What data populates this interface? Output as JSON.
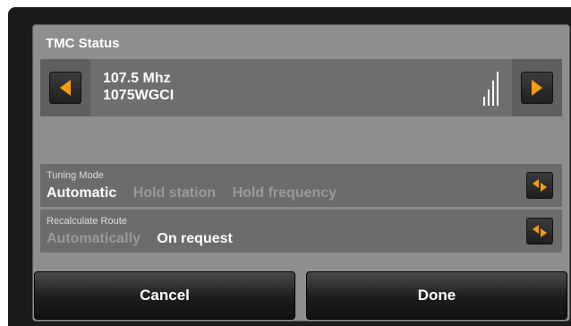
{
  "dialog": {
    "title": "TMC Status"
  },
  "station": {
    "frequency": "107.5 Mhz",
    "name": "1075WGCI",
    "signal_bars": 4
  },
  "tuning_mode": {
    "label": "Tuning Mode",
    "options": [
      "Automatic",
      "Hold station",
      "Hold frequency"
    ],
    "selected": "Automatic"
  },
  "recalculate_route": {
    "label": "Recalculate Route",
    "options": [
      "Automatically",
      "On request"
    ],
    "selected": "On request"
  },
  "actions": {
    "cancel_label": "Cancel",
    "done_label": "Done"
  },
  "colors": {
    "accent": "#f39c12",
    "active_text": "#ffffff",
    "inactive_text": "#9a9a9a"
  },
  "icons": {
    "prev": "arrow-left-icon",
    "next": "arrow-right-icon",
    "toggle": "toggle-arrows-icon",
    "signal": "signal-strength-icon"
  }
}
